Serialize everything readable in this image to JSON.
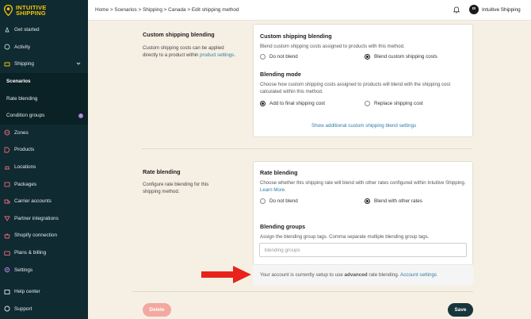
{
  "brand": {
    "name_line1": "INTUITIVE",
    "name_line2": "SHIPPING",
    "accent": "#f4c20d",
    "sidebar_bg": "#0f2a30"
  },
  "sidebar": {
    "items": [
      {
        "label": "Get started",
        "icon": "rocket-icon"
      },
      {
        "label": "Activity",
        "icon": "activity-icon"
      },
      {
        "label": "Shipping",
        "icon": "shipping-icon"
      },
      {
        "label": "Scenarios"
      },
      {
        "label": "Rate blending"
      },
      {
        "label": "Condition groups",
        "badge": "i"
      },
      {
        "label": "Zones",
        "icon": "globe-icon"
      },
      {
        "label": "Products",
        "icon": "tag-icon"
      },
      {
        "label": "Locations",
        "icon": "location-icon"
      },
      {
        "label": "Packages",
        "icon": "box-icon"
      },
      {
        "label": "Carrier accounts",
        "icon": "truck-icon"
      },
      {
        "label": "Partner integrations",
        "icon": "puzzle-icon"
      },
      {
        "label": "Shopify connection",
        "icon": "bag-icon"
      },
      {
        "label": "Plans & billing",
        "icon": "card-icon"
      },
      {
        "label": "Settings",
        "icon": "gear-icon"
      }
    ],
    "bottom": [
      {
        "label": "Help center",
        "icon": "help-icon"
      },
      {
        "label": "Support",
        "icon": "support-icon"
      }
    ]
  },
  "header": {
    "breadcrumb": "Home > Scenarios > Shipping > Canada > Edit shipping method",
    "user_initials": "IS",
    "user_name": "Intuitive Shipping"
  },
  "custom_blending": {
    "section_title": "Custom shipping blending",
    "section_desc": "Custom shipping costs can be applied directly to a product within",
    "section_link": "product settings",
    "card_title": "Custom shipping blending",
    "card_desc": "Blend custom shipping costs assigned to products with this method.",
    "option_no": "Do not blend",
    "option_yes": "Blend custom shipping costs",
    "selected": "Blend custom shipping costs",
    "mode_title": "Blending mode",
    "mode_desc": "Choose how custom shipping costs assigned to products will blend with the shipping cost calculated within this method.",
    "mode_option_add": "Add to final shipping cost",
    "mode_option_replace": "Replace shipping cost",
    "mode_selected": "Add to final shipping cost",
    "more_link": "Show additional custom shipping blend settings"
  },
  "rate_blending": {
    "section_title": "Rate blending",
    "section_desc": "Configure rate blending for this shipping method.",
    "card_title": "Rate blending",
    "card_desc": "Choose whether this shipping rate will blend with other rates configured within Intuitive Shipping.",
    "learn_more": "Learn More.",
    "option_no": "Do not blend",
    "option_yes": "Blend with other rates",
    "selected": "Blend with other rates",
    "groups_title": "Blending groups",
    "groups_desc": "Assign the blending group tags. Comma separate multiple blending group tags.",
    "groups_placeholder": "blending groups",
    "groups_value": "",
    "info_prefix": "Your account is currently setup to use",
    "info_bold": "advanced",
    "info_suffix": "rate blending.",
    "info_link": "Account settings"
  },
  "actions": {
    "delete_label": "Delete",
    "save_label": "Save"
  }
}
